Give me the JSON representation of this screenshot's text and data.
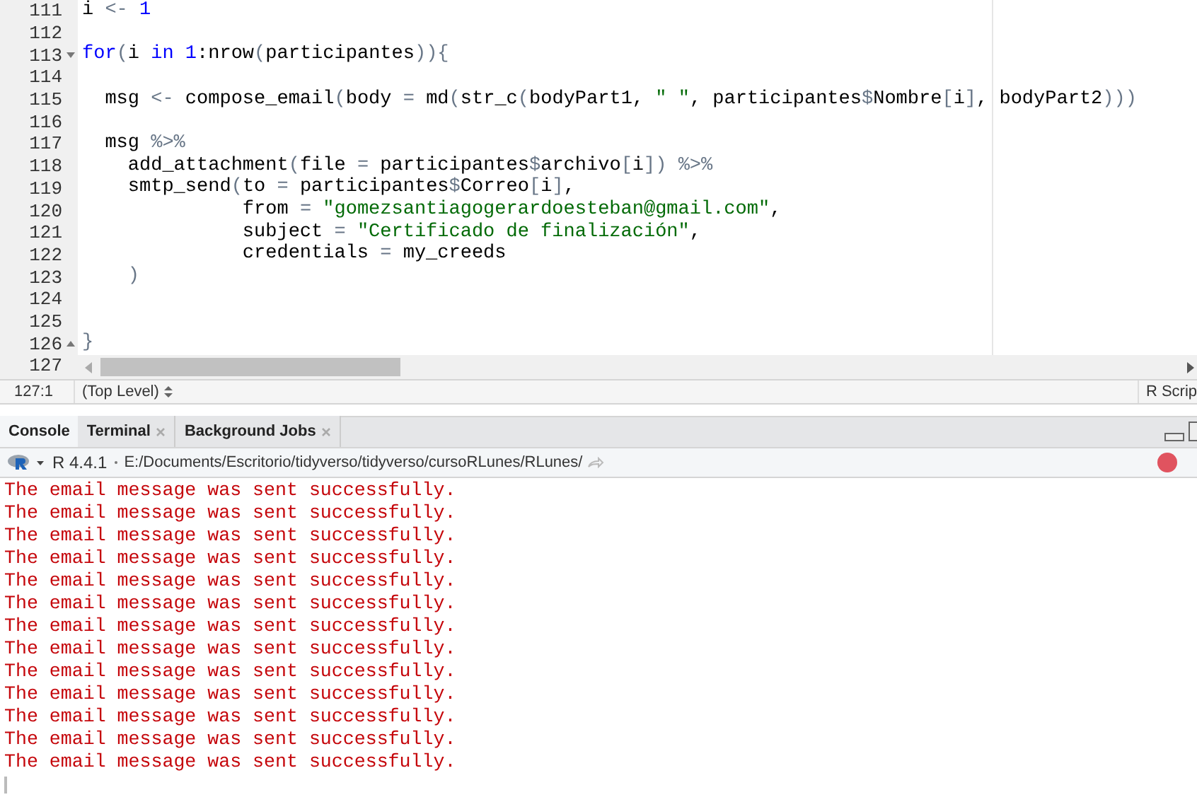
{
  "editor": {
    "lines": [
      {
        "number": "111",
        "tokens": [
          {
            "kind": "plain",
            "text": "i "
          },
          {
            "kind": "op",
            "text": "<- "
          },
          {
            "kind": "num",
            "text": "1"
          }
        ]
      },
      {
        "number": "112"
      },
      {
        "number": "113",
        "fold_start": true,
        "tokens": [
          {
            "kind": "kw",
            "text": "for"
          },
          {
            "kind": "op",
            "text": "("
          },
          {
            "kind": "plain",
            "text": "i "
          },
          {
            "kind": "kw",
            "text": "in"
          },
          {
            "kind": "num",
            "text": " 1"
          },
          {
            "kind": "plain",
            "text": ":nrow"
          },
          {
            "kind": "op",
            "text": "("
          },
          {
            "kind": "plain",
            "text": "participantes"
          },
          {
            "kind": "op",
            "text": ")){"
          }
        ]
      },
      {
        "number": "114"
      },
      {
        "number": "115",
        "tokens": [
          {
            "kind": "plain",
            "text": "  msg "
          },
          {
            "kind": "op",
            "text": "<-"
          },
          {
            "kind": "plain",
            "text": " compose_email"
          },
          {
            "kind": "op",
            "text": "("
          },
          {
            "kind": "plain",
            "text": "body "
          },
          {
            "kind": "op",
            "text": "="
          },
          {
            "kind": "plain",
            "text": " md"
          },
          {
            "kind": "op",
            "text": "("
          },
          {
            "kind": "plain",
            "text": "str_c"
          },
          {
            "kind": "op",
            "text": "("
          },
          {
            "kind": "plain",
            "text": "bodyPart1, "
          },
          {
            "kind": "str",
            "text": "\" \""
          },
          {
            "kind": "plain",
            "text": ", participantes"
          },
          {
            "kind": "op",
            "text": "$"
          },
          {
            "kind": "plain",
            "text": "Nombre"
          },
          {
            "kind": "op",
            "text": "["
          },
          {
            "kind": "plain",
            "text": "i"
          },
          {
            "kind": "op",
            "text": "]"
          },
          {
            "kind": "plain",
            "text": ", bodyPart2"
          },
          {
            "kind": "op",
            "text": ")))"
          }
        ]
      },
      {
        "number": "116"
      },
      {
        "number": "117",
        "tokens": [
          {
            "kind": "plain",
            "text": "  msg "
          },
          {
            "kind": "op",
            "text": "%>%"
          }
        ]
      },
      {
        "number": "118",
        "tokens": [
          {
            "kind": "plain",
            "text": "    add_attachment"
          },
          {
            "kind": "op",
            "text": "("
          },
          {
            "kind": "plain",
            "text": "file "
          },
          {
            "kind": "op",
            "text": "="
          },
          {
            "kind": "plain",
            "text": " participantes"
          },
          {
            "kind": "op",
            "text": "$"
          },
          {
            "kind": "plain",
            "text": "archivo"
          },
          {
            "kind": "op",
            "text": "["
          },
          {
            "kind": "plain",
            "text": "i"
          },
          {
            "kind": "op",
            "text": "]) %>%"
          }
        ]
      },
      {
        "number": "119",
        "tokens": [
          {
            "kind": "plain",
            "text": "    smtp_send"
          },
          {
            "kind": "op",
            "text": "("
          },
          {
            "kind": "plain",
            "text": "to "
          },
          {
            "kind": "op",
            "text": "="
          },
          {
            "kind": "plain",
            "text": " participantes"
          },
          {
            "kind": "op",
            "text": "$"
          },
          {
            "kind": "plain",
            "text": "Correo"
          },
          {
            "kind": "op",
            "text": "["
          },
          {
            "kind": "plain",
            "text": "i"
          },
          {
            "kind": "op",
            "text": "]"
          },
          {
            "kind": "plain",
            "text": ","
          }
        ]
      },
      {
        "number": "120",
        "tokens": [
          {
            "kind": "plain",
            "text": "              from "
          },
          {
            "kind": "op",
            "text": "= "
          },
          {
            "kind": "str",
            "text": "\"gomezsantiagogerardoesteban@gmail.com\""
          },
          {
            "kind": "plain",
            "text": ","
          }
        ]
      },
      {
        "number": "121",
        "tokens": [
          {
            "kind": "plain",
            "text": "              subject "
          },
          {
            "kind": "op",
            "text": "= "
          },
          {
            "kind": "str",
            "text": "\"Certificado de finalización\""
          },
          {
            "kind": "plain",
            "text": ","
          }
        ]
      },
      {
        "number": "122",
        "tokens": [
          {
            "kind": "plain",
            "text": "              credentials "
          },
          {
            "kind": "op",
            "text": "="
          },
          {
            "kind": "plain",
            "text": " my_creeds"
          }
        ]
      },
      {
        "number": "123",
        "tokens": [
          {
            "kind": "op",
            "text": "    )"
          }
        ]
      },
      {
        "number": "124"
      },
      {
        "number": "125"
      },
      {
        "number": "126",
        "fold_end": true,
        "tokens": [
          {
            "kind": "op",
            "text": "}"
          }
        ]
      },
      {
        "number": "127"
      }
    ]
  },
  "status_bar": {
    "position": "127:1",
    "scope": "(Top Level)",
    "file_type": "R Scrip"
  },
  "tabs": [
    {
      "label": "Console",
      "selected": true,
      "closable": false
    },
    {
      "label": "Terminal",
      "selected": false,
      "closable": true
    },
    {
      "label": "Background Jobs",
      "selected": false,
      "closable": true
    }
  ],
  "console_toolbar": {
    "version": "R 4.4.1",
    "path": "E:/Documents/Escritorio/tidyverso/tidyverso/cursoRLunes/RLunes/"
  },
  "console": {
    "lines": [
      "The email message was sent successfully.",
      "The email message was sent successfully.",
      "The email message was sent successfully.",
      "The email message was sent successfully.",
      "The email message was sent successfully.",
      "The email message was sent successfully.",
      "The email message was sent successfully.",
      "The email message was sent successfully.",
      "The email message was sent successfully.",
      "The email message was sent successfully.",
      "The email message was sent successfully.",
      "The email message was sent successfully.",
      "The email message was sent successfully."
    ]
  }
}
